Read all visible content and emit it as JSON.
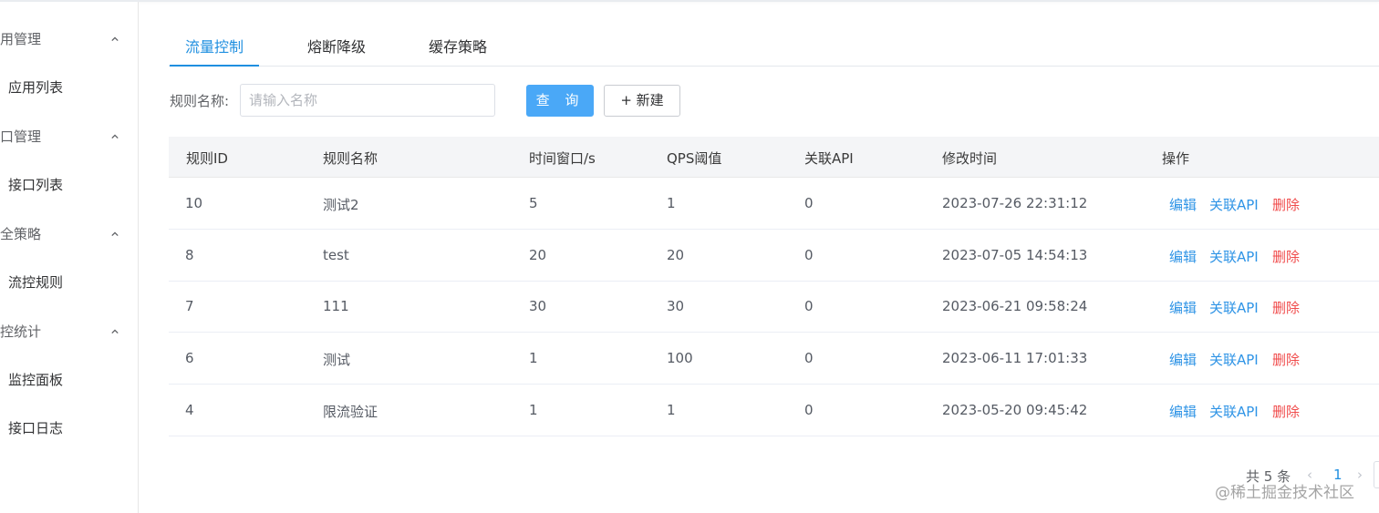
{
  "sidebar": {
    "groups": [
      {
        "title": "用管理",
        "items": [
          "应用列表"
        ]
      },
      {
        "title": "口管理",
        "items": [
          "接口列表"
        ]
      },
      {
        "title": "全策略",
        "items": [
          "流控规则"
        ]
      },
      {
        "title": "控统计",
        "items": [
          "监控面板",
          "接口日志"
        ]
      }
    ]
  },
  "tabs": [
    {
      "label": "流量控制",
      "active": true
    },
    {
      "label": "熔断降级",
      "active": false
    },
    {
      "label": "缓存策略",
      "active": false
    }
  ],
  "search": {
    "label": "规则名称:",
    "placeholder": "请输入名称",
    "value": "",
    "query_label": "查 询",
    "new_label": "+ 新建"
  },
  "table": {
    "columns": [
      "规则ID",
      "规则名称",
      "时间窗口/s",
      "QPS阈值",
      "关联API",
      "修改时间",
      "操作"
    ],
    "rows": [
      {
        "id": "10",
        "name": "测试2",
        "window": "5",
        "qps": "1",
        "api": "0",
        "time": "2023-07-26 22:31:12"
      },
      {
        "id": "8",
        "name": "test",
        "window": "20",
        "qps": "20",
        "api": "0",
        "time": "2023-07-05 14:54:13"
      },
      {
        "id": "7",
        "name": "111",
        "window": "30",
        "qps": "30",
        "api": "0",
        "time": "2023-06-21 09:58:24"
      },
      {
        "id": "6",
        "name": "测试",
        "window": "1",
        "qps": "100",
        "api": "0",
        "time": "2023-06-11 17:01:33"
      },
      {
        "id": "4",
        "name": "限流验证",
        "window": "1",
        "qps": "1",
        "api": "0",
        "time": "2023-05-20 09:45:42"
      }
    ],
    "actions": {
      "edit": "编辑",
      "link": "关联API",
      "delete": "删除"
    }
  },
  "pagination": {
    "total": "共 5 条",
    "current": "1",
    "prev": "‹",
    "next": "›"
  },
  "watermark": "@稀土掘金技术社区",
  "colors": {
    "accent": "#1f8fe0",
    "button": "#4aa8f7",
    "danger": "#f04b4b"
  }
}
